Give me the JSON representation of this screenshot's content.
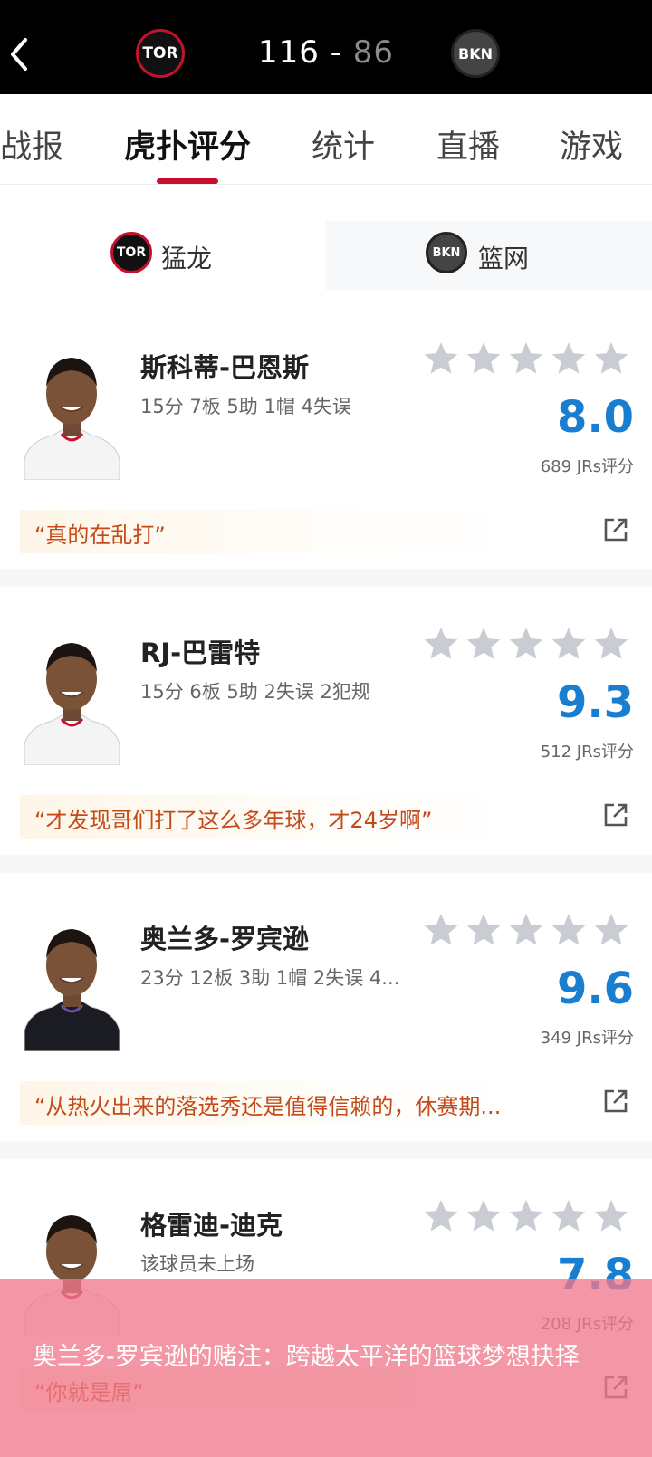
{
  "header": {
    "home_abbr": "TOR",
    "away_abbr": "BKN",
    "home_score": "116",
    "separator": "-",
    "away_score": "86"
  },
  "tabs": [
    {
      "label": "战报",
      "active": false
    },
    {
      "label": "虎扑评分",
      "active": true
    },
    {
      "label": "统计",
      "active": false
    },
    {
      "label": "直播",
      "active": false
    },
    {
      "label": "游戏",
      "active": false
    }
  ],
  "team_switch": {
    "left": {
      "abbr": "TOR",
      "name": "猛龙",
      "selected": true
    },
    "right": {
      "abbr": "BKN",
      "name": "篮网",
      "selected": false
    }
  },
  "players": [
    {
      "name": "斯科蒂-巴恩斯",
      "stats": "15分 7板 5助 1帽 4失误",
      "rating": "8.0",
      "votes": "689 JRs评分",
      "quote": "“真的在乱打”",
      "jersey": "white"
    },
    {
      "name": "RJ-巴雷特",
      "stats": "15分 6板 5助 2失误 2犯规",
      "rating": "9.3",
      "votes": "512 JRs评分",
      "quote": "“才发现哥们打了这么多年球，才24岁啊”",
      "jersey": "white"
    },
    {
      "name": "奥兰多-罗宾逊",
      "stats": "23分 12板 3助 1帽 2失误 4...",
      "rating": "9.6",
      "votes": "349 JRs评分",
      "quote": "“从热火出来的落选秀还是值得信赖的，休赛期...",
      "jersey": "black"
    },
    {
      "name": "格雷迪-迪克",
      "stats": "该球员未上场",
      "rating": "7.8",
      "votes": "208 JRs评分",
      "quote": "“你就是屌”",
      "jersey": "white"
    }
  ],
  "overlay": {
    "caption": "奥兰多-罗宾逊的赌注：跨越太平洋的篮球梦想抉择"
  },
  "colors": {
    "accent": "#c8102e",
    "rating": "#1a7ed0",
    "quote": "#c44a1a",
    "star": "#c9ccd3"
  },
  "icons": {
    "back": "chevron-left-icon",
    "share": "share-external-icon",
    "star": "star-icon"
  }
}
